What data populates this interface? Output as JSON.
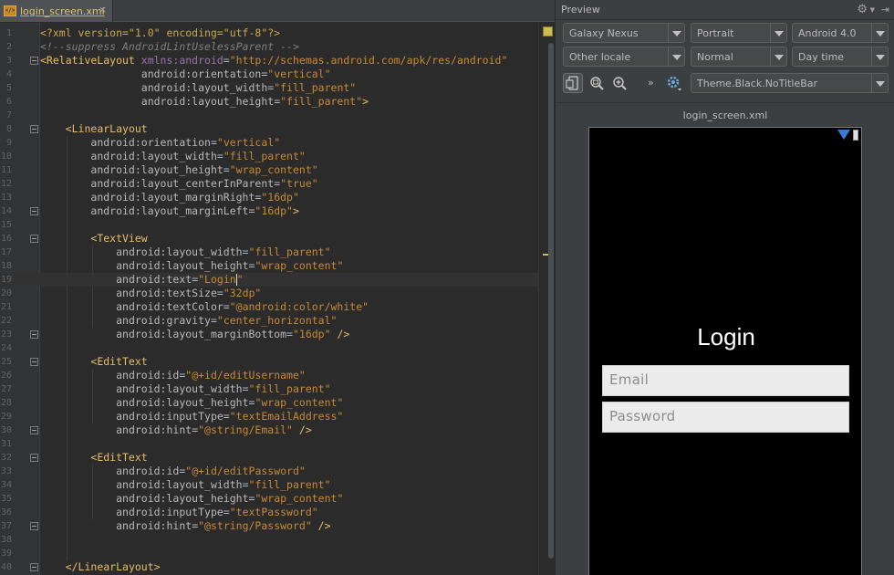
{
  "editor": {
    "tab": {
      "label": "login_screen.xml",
      "icon": "xml-file-icon",
      "close": "×"
    },
    "lines": [
      {
        "n": "1",
        "parts": [
          [
            "pi",
            "<?xml version=\"1.0\" encoding=\"utf-8\"?>"
          ]
        ]
      },
      {
        "n": "2",
        "parts": [
          [
            "cm",
            "<!--suppress AndroidLintUselessParent -->"
          ]
        ]
      },
      {
        "n": "3",
        "parts": [
          [
            "tag",
            "<RelativeLayout "
          ],
          [
            "ns",
            "xmlns:android"
          ],
          [
            "plain",
            "="
          ],
          [
            "val",
            "\"http://schemas.android.com/apk/res/android\""
          ]
        ]
      },
      {
        "n": "4",
        "parts": [
          [
            "plain",
            "                "
          ],
          [
            "attr",
            "android:orientation"
          ],
          [
            "plain",
            "="
          ],
          [
            "val",
            "\"vertical\""
          ]
        ]
      },
      {
        "n": "5",
        "parts": [
          [
            "plain",
            "                "
          ],
          [
            "attr",
            "android:layout_width"
          ],
          [
            "plain",
            "="
          ],
          [
            "val",
            "\"fill_parent\""
          ]
        ]
      },
      {
        "n": "6",
        "parts": [
          [
            "plain",
            "                "
          ],
          [
            "attr",
            "android:layout_height"
          ],
          [
            "plain",
            "="
          ],
          [
            "val",
            "\"fill_parent\""
          ],
          [
            "tag",
            ">"
          ]
        ]
      },
      {
        "n": "7",
        "parts": []
      },
      {
        "n": "8",
        "parts": [
          [
            "plain",
            "    "
          ],
          [
            "tag",
            "<LinearLayout"
          ]
        ]
      },
      {
        "n": "9",
        "parts": [
          [
            "plain",
            "        "
          ],
          [
            "attr",
            "android:orientation"
          ],
          [
            "plain",
            "="
          ],
          [
            "val",
            "\"vertical\""
          ]
        ]
      },
      {
        "n": "10",
        "parts": [
          [
            "plain",
            "        "
          ],
          [
            "attr",
            "android:layout_width"
          ],
          [
            "plain",
            "="
          ],
          [
            "val",
            "\"fill_parent\""
          ]
        ]
      },
      {
        "n": "11",
        "parts": [
          [
            "plain",
            "        "
          ],
          [
            "attr",
            "android:layout_height"
          ],
          [
            "plain",
            "="
          ],
          [
            "val",
            "\"wrap_content\""
          ]
        ]
      },
      {
        "n": "12",
        "parts": [
          [
            "plain",
            "        "
          ],
          [
            "attr",
            "android:layout_centerInParent"
          ],
          [
            "plain",
            "="
          ],
          [
            "val",
            "\"true\""
          ]
        ]
      },
      {
        "n": "13",
        "parts": [
          [
            "plain",
            "        "
          ],
          [
            "attr",
            "android:layout_marginRight"
          ],
          [
            "plain",
            "="
          ],
          [
            "val",
            "\"16dp\""
          ]
        ]
      },
      {
        "n": "14",
        "parts": [
          [
            "plain",
            "        "
          ],
          [
            "attr",
            "android:layout_marginLeft"
          ],
          [
            "plain",
            "="
          ],
          [
            "val",
            "\"16dp\""
          ],
          [
            "tag",
            ">"
          ]
        ]
      },
      {
        "n": "15",
        "parts": []
      },
      {
        "n": "16",
        "parts": [
          [
            "plain",
            "        "
          ],
          [
            "tag",
            "<TextView"
          ]
        ]
      },
      {
        "n": "17",
        "parts": [
          [
            "plain",
            "            "
          ],
          [
            "attr",
            "android:layout_width"
          ],
          [
            "plain",
            "="
          ],
          [
            "val",
            "\"fill_parent\""
          ]
        ]
      },
      {
        "n": "18",
        "parts": [
          [
            "plain",
            "            "
          ],
          [
            "attr",
            "android:layout_height"
          ],
          [
            "plain",
            "="
          ],
          [
            "val",
            "\"wrap_content\""
          ]
        ]
      },
      {
        "n": "19",
        "parts": [
          [
            "plain",
            "            "
          ],
          [
            "attr",
            "android:text"
          ],
          [
            "plain",
            "="
          ],
          [
            "val",
            "\"Login"
          ],
          [
            "caret",
            ""
          ],
          [
            "val",
            "\""
          ]
        ]
      },
      {
        "n": "20",
        "parts": [
          [
            "plain",
            "            "
          ],
          [
            "attr",
            "android:textSize"
          ],
          [
            "plain",
            "="
          ],
          [
            "val",
            "\"32dp\""
          ]
        ]
      },
      {
        "n": "21",
        "parts": [
          [
            "plain",
            "            "
          ],
          [
            "attr",
            "android:textColor"
          ],
          [
            "plain",
            "="
          ],
          [
            "val",
            "\"@android:color/white\""
          ]
        ]
      },
      {
        "n": "22",
        "parts": [
          [
            "plain",
            "            "
          ],
          [
            "attr",
            "android:gravity"
          ],
          [
            "plain",
            "="
          ],
          [
            "val",
            "\"center_horizontal\""
          ]
        ]
      },
      {
        "n": "23",
        "parts": [
          [
            "plain",
            "            "
          ],
          [
            "attr",
            "android:layout_marginBottom"
          ],
          [
            "plain",
            "="
          ],
          [
            "val",
            "\"16dp\""
          ],
          [
            "tag",
            " />"
          ]
        ]
      },
      {
        "n": "24",
        "parts": []
      },
      {
        "n": "25",
        "parts": [
          [
            "plain",
            "        "
          ],
          [
            "tag",
            "<EditText"
          ]
        ]
      },
      {
        "n": "26",
        "parts": [
          [
            "plain",
            "            "
          ],
          [
            "attr",
            "android:id"
          ],
          [
            "plain",
            "="
          ],
          [
            "val",
            "\"@+id/editUsername\""
          ]
        ]
      },
      {
        "n": "27",
        "parts": [
          [
            "plain",
            "            "
          ],
          [
            "attr",
            "android:layout_width"
          ],
          [
            "plain",
            "="
          ],
          [
            "val",
            "\"fill_parent\""
          ]
        ]
      },
      {
        "n": "28",
        "parts": [
          [
            "plain",
            "            "
          ],
          [
            "attr",
            "android:layout_height"
          ],
          [
            "plain",
            "="
          ],
          [
            "val",
            "\"wrap_content\""
          ]
        ]
      },
      {
        "n": "29",
        "parts": [
          [
            "plain",
            "            "
          ],
          [
            "attr",
            "android:inputType"
          ],
          [
            "plain",
            "="
          ],
          [
            "val",
            "\"textEmailAddress\""
          ]
        ]
      },
      {
        "n": "30",
        "parts": [
          [
            "plain",
            "            "
          ],
          [
            "attr",
            "android:hint"
          ],
          [
            "plain",
            "="
          ],
          [
            "val",
            "\"@string/Email\""
          ],
          [
            "tag",
            " />"
          ]
        ]
      },
      {
        "n": "31",
        "parts": []
      },
      {
        "n": "32",
        "parts": [
          [
            "plain",
            "        "
          ],
          [
            "tag",
            "<EditText"
          ]
        ]
      },
      {
        "n": "33",
        "parts": [
          [
            "plain",
            "            "
          ],
          [
            "attr",
            "android:id"
          ],
          [
            "plain",
            "="
          ],
          [
            "val",
            "\"@+id/editPassword\""
          ]
        ]
      },
      {
        "n": "34",
        "parts": [
          [
            "plain",
            "            "
          ],
          [
            "attr",
            "android:layout_width"
          ],
          [
            "plain",
            "="
          ],
          [
            "val",
            "\"fill_parent\""
          ]
        ]
      },
      {
        "n": "35",
        "parts": [
          [
            "plain",
            "            "
          ],
          [
            "attr",
            "android:layout_height"
          ],
          [
            "plain",
            "="
          ],
          [
            "val",
            "\"wrap_content\""
          ]
        ]
      },
      {
        "n": "36",
        "parts": [
          [
            "plain",
            "            "
          ],
          [
            "attr",
            "android:inputType"
          ],
          [
            "plain",
            "="
          ],
          [
            "val",
            "\"textPassword\""
          ]
        ]
      },
      {
        "n": "37",
        "parts": [
          [
            "plain",
            "            "
          ],
          [
            "attr",
            "android:hint"
          ],
          [
            "plain",
            "="
          ],
          [
            "val",
            "\"@string/Password\""
          ],
          [
            "tag",
            " />"
          ]
        ]
      },
      {
        "n": "38",
        "parts": []
      },
      {
        "n": "39",
        "parts": []
      },
      {
        "n": "40",
        "parts": [
          [
            "plain",
            "    "
          ],
          [
            "tag",
            "</LinearLayout>"
          ]
        ]
      }
    ],
    "folds": [
      "3",
      "8",
      "14",
      "16",
      "23",
      "25",
      "30",
      "32",
      "37",
      "40"
    ],
    "current_line": "19"
  },
  "preview": {
    "title": "Preview",
    "icons": {
      "settings": "gear-icon",
      "hide": "hide-panel-icon"
    },
    "config": {
      "device": "Galaxy Nexus",
      "orientation": "Portrait",
      "api": "Android 4.0",
      "locale": "Other locale",
      "ui_mode": "Normal",
      "night_mode": "Day time",
      "theme": "Theme.Black.NoTitleBar"
    },
    "toolbar": {
      "more": "»",
      "buttons": [
        "device-frame-icon",
        "zoom-actual-icon",
        "zoom-in-icon",
        "render-settings-icon"
      ]
    },
    "render_title": "login_screen.xml",
    "screen": {
      "login_text": "Login",
      "email_hint": "Email",
      "password_hint": "Password"
    },
    "colors": {
      "wifi": "#3a7bd5",
      "screen_bg": "#000000",
      "login_text": "#ffffff"
    }
  }
}
